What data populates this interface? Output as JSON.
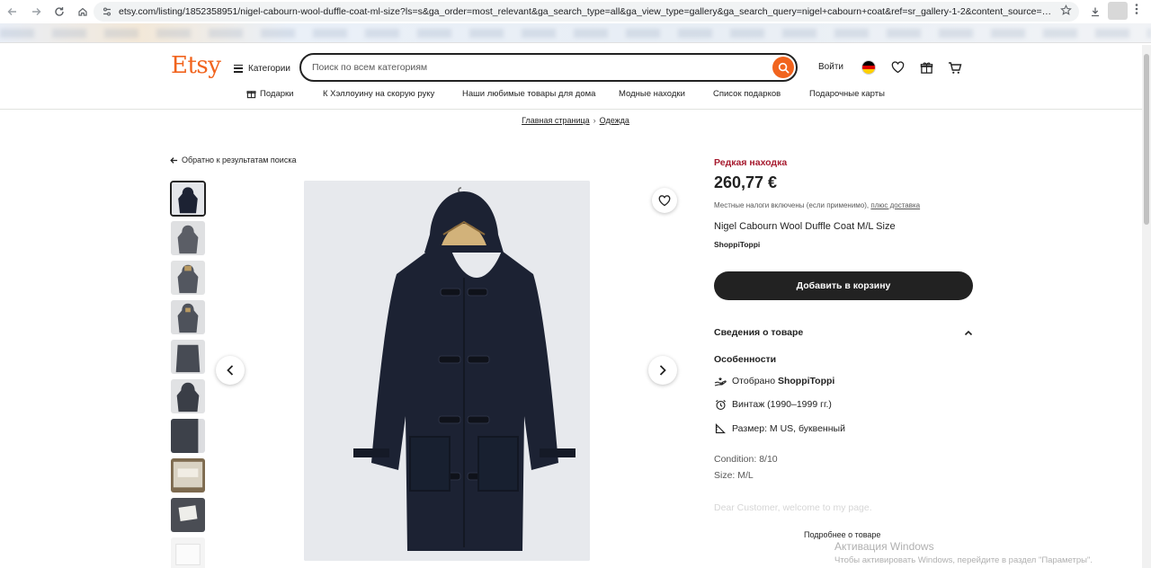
{
  "browser": {
    "url": "etsy.com/listing/1852358951/nigel-cabourn-wool-duffle-coat-ml-size?ls=s&ga_order=most_relevant&ga_search_type=all&ga_view_type=gallery&ga_search_query=nigel+cabourn+coat&ref=sr_gallery-1-2&content_source=492c7e5b-8d5a-4140-bc5e-..."
  },
  "header": {
    "logo": "Etsy",
    "categories_label": "Категории",
    "search_placeholder": "Поиск по всем категориям",
    "sign_in": "Войти",
    "flag_colors": [
      "#000000",
      "#dd0000",
      "#ffce00"
    ],
    "nav": [
      {
        "label": "Подарки",
        "icon": "gift-icon"
      },
      {
        "label": "К Хэллоуину на скорую руку"
      },
      {
        "label": "Наши любимые товары для дома"
      },
      {
        "label": "Модные находки"
      },
      {
        "label": "Список подарков"
      },
      {
        "label": "Подарочные карты"
      }
    ]
  },
  "breadcrumb": {
    "items": [
      "Главная страница",
      "Одежда"
    ]
  },
  "gallery": {
    "back_link": "Обратно к результатам поиска",
    "thumbnail_count": 10,
    "active_index": 0
  },
  "product": {
    "badge": "Редкая находка",
    "price": "260,77 €",
    "tax_note": "Местные налоги включены (если применимо),",
    "tax_link": "плюс доставка",
    "title": "Nigel Cabourn Wool Duffle Coat M/L Size",
    "shop": "ShoppiToppi",
    "add_to_cart": "Добавить в корзину"
  },
  "details": {
    "header": "Сведения о товаре",
    "features_heading": "Особенности",
    "features": [
      {
        "prefix": "Отобрано ",
        "bold": "ShoppiToppi",
        "icon": "hand-picked-icon"
      },
      {
        "prefix": "Винтаж (1990–1999 гг.)",
        "bold": "",
        "icon": "alarm-clock-icon"
      },
      {
        "prefix": "Размер: M US, буквенный",
        "bold": "",
        "icon": "ruler-triangle-icon"
      }
    ],
    "condition": "Condition: 8/10",
    "size": "Size: M/L",
    "description_start": "Dear Customer, welcome to my page.",
    "more_link": "Подробнее о товаре"
  },
  "overlay": {
    "windows_title": "Активация Windows",
    "windows_sub": "Чтобы активировать Windows, перейдите в раздел \"Параметры\"."
  },
  "colors": {
    "brand": "#f1641e",
    "rare": "#a61a2e",
    "coat": "#1c2233"
  }
}
